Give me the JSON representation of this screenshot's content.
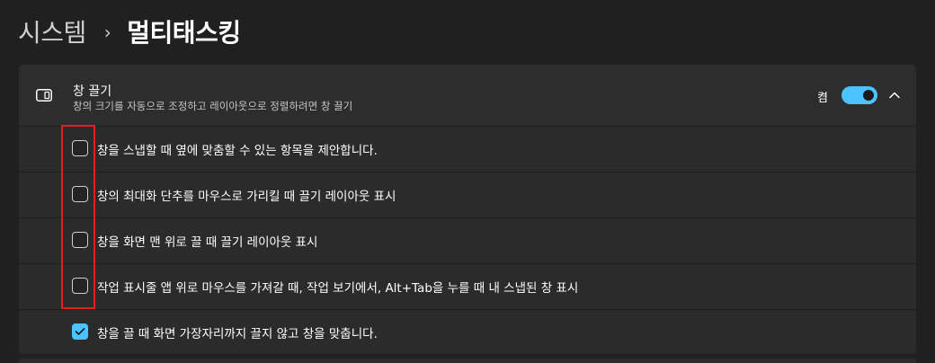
{
  "breadcrumb": {
    "parent": "시스템",
    "separator": "›",
    "current": "멀티태스킹"
  },
  "snap": {
    "title": "창 끌기",
    "subtitle": "창의 크기를 자동으로 조정하고 레이아웃으로 정렬하려면 창 끌기",
    "toggle_label": "켬",
    "toggle_on": true,
    "icon": "snap-window-icon",
    "expanded": true
  },
  "options": [
    {
      "label": "창을 스냅할 때 옆에 맞춤할 수 있는 항목을 제안합니다.",
      "checked": false
    },
    {
      "label": "창의 최대화 단추를 마우스로 가리킬 때 끌기 레이아웃 표시",
      "checked": false
    },
    {
      "label": "창을 화면 맨 위로 끌 때 끌기 레이아웃 표시",
      "checked": false
    },
    {
      "label": "작업 표시줄 앱 위로 마우스를 가져갈 때, 작업 보기에서, Alt+Tab을 누를 때 내 스냅된 창 표시",
      "checked": false
    },
    {
      "label": "창을 끌 때 화면 가장자리까지 끌지 않고 창을 맞춥니다.",
      "checked": true
    }
  ],
  "colors": {
    "accent": "#4cc2ff",
    "background": "#202020",
    "card": "#2b2b2b",
    "highlight": "#e0211f"
  }
}
